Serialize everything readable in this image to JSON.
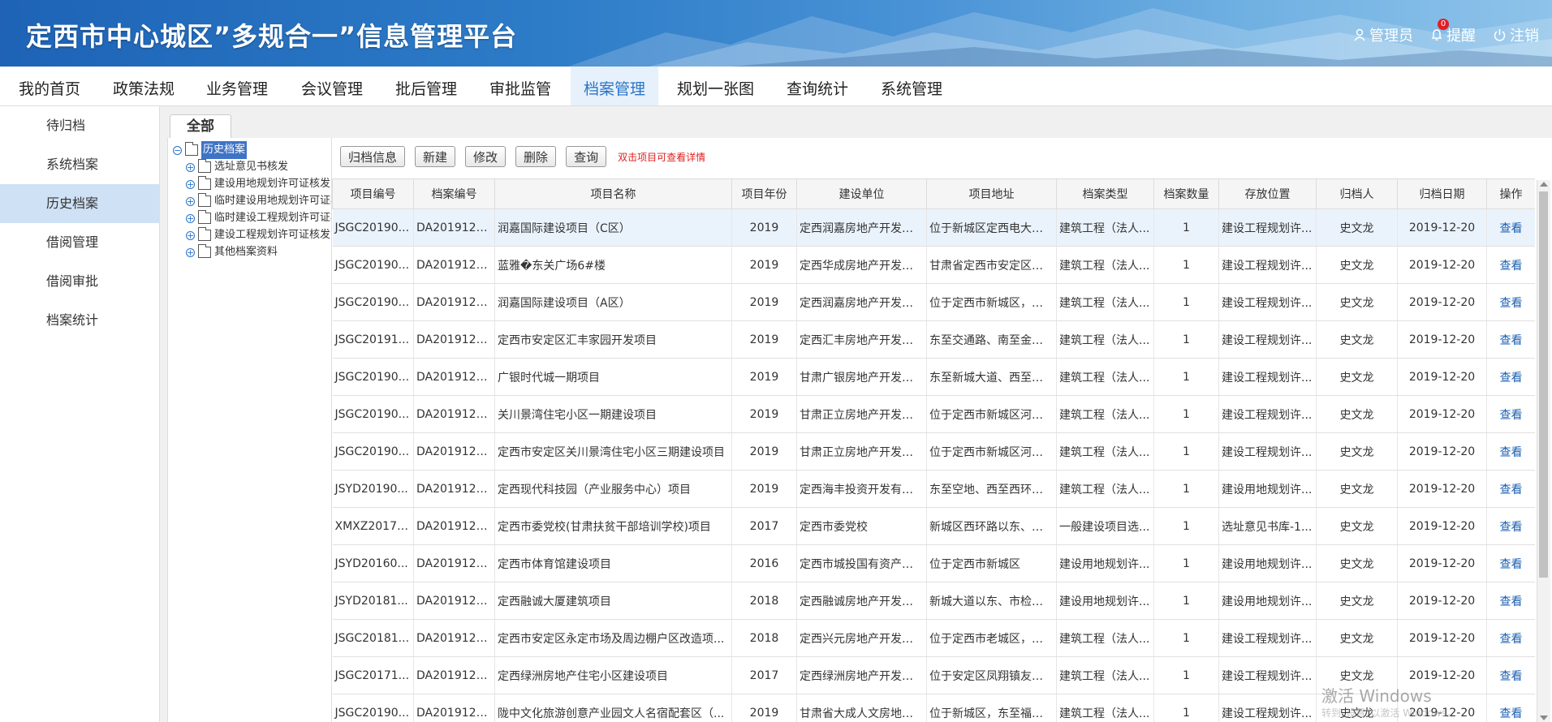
{
  "app": {
    "title": "定西市中心城区”多规合一”信息管理平台",
    "user_label": "管理员",
    "remind_label": "提醒",
    "remind_count": "0",
    "logout_label": "注销"
  },
  "nav": [
    {
      "label": "我的首页"
    },
    {
      "label": "政策法规"
    },
    {
      "label": "业务管理"
    },
    {
      "label": "会议管理"
    },
    {
      "label": "批后管理"
    },
    {
      "label": "审批监管"
    },
    {
      "label": "档案管理",
      "active": true
    },
    {
      "label": "规划一张图"
    },
    {
      "label": "查询统计"
    },
    {
      "label": "系统管理"
    }
  ],
  "sidebar": [
    {
      "label": "待归档"
    },
    {
      "label": "系统档案"
    },
    {
      "label": "历史档案",
      "active": true
    },
    {
      "label": "借阅管理"
    },
    {
      "label": "借阅审批"
    },
    {
      "label": "档案统计"
    }
  ],
  "tab": {
    "label": "全部"
  },
  "tree": {
    "root": "历史档案",
    "children": [
      "选址意见书核发",
      "建设用地规划许可证核发",
      "临时建设用地规划许可证核发",
      "临时建设工程规划许可证核发",
      "建设工程规划许可证核发",
      "其他档案资料"
    ]
  },
  "toolbar": {
    "buttons": [
      "归档信息",
      "新建",
      "修改",
      "删除",
      "查询"
    ],
    "hint": "双击项目可查看详情"
  },
  "table": {
    "headers": [
      "项目编号",
      "档案编号",
      "项目名称",
      "项目年份",
      "建设单位",
      "项目地址",
      "档案类型",
      "档案数量",
      "存放位置",
      "归档人",
      "归档日期",
      "操作"
    ],
    "rows": [
      [
        "JSGC20190...",
        "DA2019122...",
        "润嘉国际建设项目（C区）",
        "2019",
        "定西润嘉房地产开发有...",
        "位于新城区定西电大校...",
        "建筑工程（法人...",
        "1",
        "建设工程规划许...",
        "史文龙",
        "2019-12-20",
        "查看"
      ],
      [
        "JSGC20190...",
        "DA2019122...",
        "蓝雅�东关广场6#楼",
        "2019",
        "定西华成房地产开发有...",
        "甘肃省定西市安定区原...",
        "建筑工程（法人...",
        "1",
        "建设工程规划许...",
        "史文龙",
        "2019-12-20",
        "查看"
      ],
      [
        "JSGC20190...",
        "DA2019122...",
        "润嘉国际建设项目（A区）",
        "2019",
        "定西润嘉房地产开发有...",
        "位于定西市新城区，东...",
        "建筑工程（法人...",
        "1",
        "建设工程规划许...",
        "史文龙",
        "2019-12-20",
        "查看"
      ],
      [
        "JSGC20191...",
        "DA2019122...",
        "定西市安定区汇丰家园开发项目",
        "2019",
        "定西汇丰房地产开发有...",
        "东至交通路、南至金荣...",
        "建筑工程（法人...",
        "1",
        "建设工程规划许...",
        "史文龙",
        "2019-12-20",
        "查看"
      ],
      [
        "JSGC20190...",
        "DA2019122...",
        "广银时代城一期项目",
        "2019",
        "甘肃广银房地产开发有...",
        "东至新城大道、西至定...",
        "建筑工程（法人...",
        "1",
        "建设工程规划许...",
        "史文龙",
        "2019-12-20",
        "查看"
      ],
      [
        "JSGC20190...",
        "DA2019122...",
        "关川景湾住宅小区一期建设项目",
        "2019",
        "甘肃正立房地产开发有...",
        "位于定西市新城区河东...",
        "建筑工程（法人...",
        "1",
        "建设工程规划许...",
        "史文龙",
        "2019-12-20",
        "查看"
      ],
      [
        "JSGC20190...",
        "DA2019122...",
        "定西市安定区关川景湾住宅小区三期建设项目",
        "2019",
        "甘肃正立房地产开发有...",
        "位于定西市新城区河东...",
        "建筑工程（法人...",
        "1",
        "建设工程规划许...",
        "史文龙",
        "2019-12-20",
        "查看"
      ],
      [
        "JSYD20190...",
        "DA2019122...",
        "定西现代科技园（产业服务中心）项目",
        "2019",
        "定西海丰投资开发有限...",
        "东至空地、西至西环路...",
        "建筑工程（法人...",
        "1",
        "建设用地规划许...",
        "史文龙",
        "2019-12-20",
        "查看"
      ],
      [
        "XMXZ20170...",
        "DA2019122...",
        "定西市委党校(甘肃扶贫干部培训学校)项目",
        "2017",
        "定西市委党校",
        "新城区西环路以东、定...",
        "一般建设项目选...",
        "1",
        "选址意见书库-1...",
        "史文龙",
        "2019-12-20",
        "查看"
      ],
      [
        "JSYD20160...",
        "DA2019122...",
        "定西市体育馆建设项目",
        "2016",
        "定西市城投国有资产有...",
        "位于定西市新城区",
        "建设用地规划许...",
        "1",
        "建设用地规划许...",
        "史文龙",
        "2019-12-20",
        "查看"
      ],
      [
        "JSYD20181...",
        "DA2019122...",
        "定西融诚大厦建筑项目",
        "2018",
        "定西融诚房地产开发有...",
        "新城大道以东、市检察...",
        "建设用地规划许...",
        "1",
        "建设用地规划许...",
        "史文龙",
        "2019-12-20",
        "查看"
      ],
      [
        "JSGC20181...",
        "DA2019122...",
        "定西市安定区永定市场及周边棚户区改造项...",
        "2018",
        "定西兴元房地产开发有...",
        "位于定西市老城区，东...",
        "建筑工程（法人...",
        "1",
        "建设工程规划许...",
        "史文龙",
        "2019-12-20",
        "查看"
      ],
      [
        "JSGC20171...",
        "DA2019122...",
        "定西绿洲房地产住宅小区建设项目",
        "2017",
        "定西绿洲房地产开发有...",
        "位于安定区凤翔镇友谊...",
        "建筑工程（法人...",
        "1",
        "建设工程规划许...",
        "史文龙",
        "2019-12-20",
        "查看"
      ],
      [
        "JSGC20190...",
        "DA2019122...",
        "陇中文化旅游创意产业园文人名宿配套区（...",
        "2019",
        "甘肃省大成人文房地产...",
        "位于新城区，东至福台...",
        "建筑工程（法人...",
        "1",
        "建设工程规划许...",
        "史文龙",
        "2019-12-20",
        "查看"
      ]
    ]
  },
  "watermark": {
    "line1": "激活 Windows",
    "line2": "转到“设置”以激活 Windows。"
  },
  "colors": {
    "header_blue": "#1e63b6",
    "nav_active": "#2a74c6",
    "sidebar_active": "#cfe1f5",
    "link": "#1a5fb4",
    "hint_red": "#e02020"
  }
}
